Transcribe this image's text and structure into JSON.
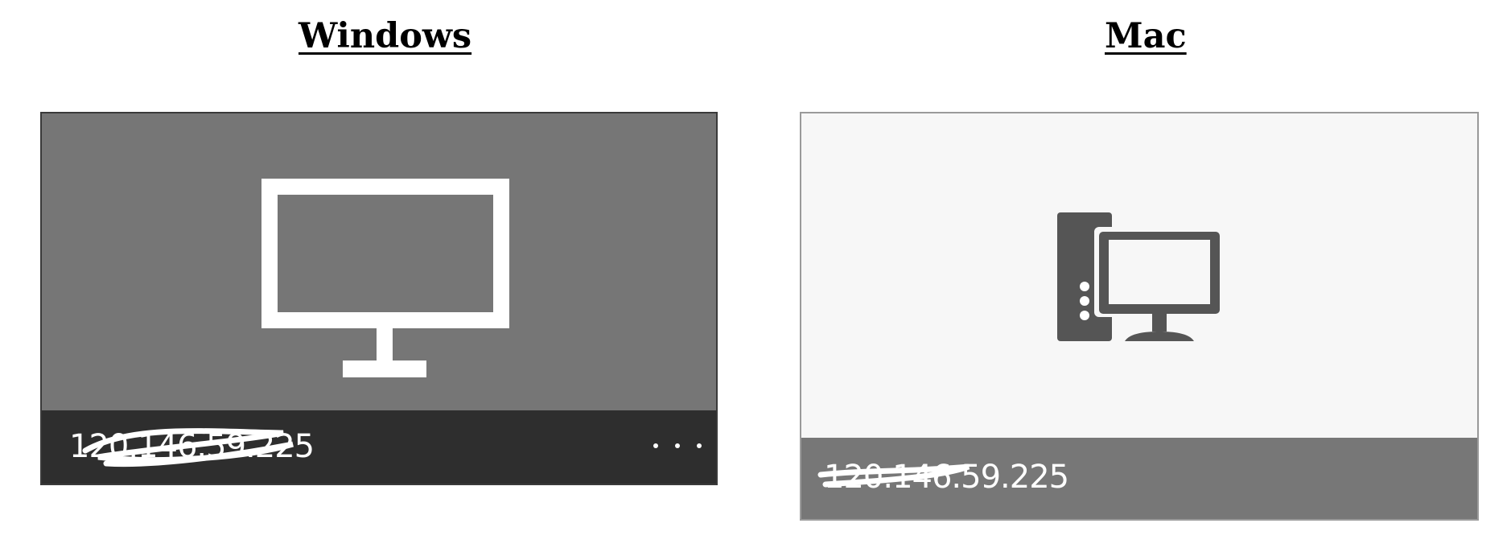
{
  "headings": {
    "windows": "Windows",
    "mac": "Mac"
  },
  "windows_tile": {
    "ip_address": "120.146.59.225",
    "more_options_icon": "more-horizontal-icon",
    "device_icon": "monitor-icon",
    "colors": {
      "thumbnail_bg": "#767676",
      "footer_bg": "#2e2e2e",
      "icon": "#ffffff"
    }
  },
  "mac_tile": {
    "ip_address": "120.146.59.225",
    "device_icon": "desktop-computer-icon",
    "colors": {
      "thumbnail_bg": "#f7f7f7",
      "footer_bg": "#777777",
      "icon": "#555555"
    }
  }
}
